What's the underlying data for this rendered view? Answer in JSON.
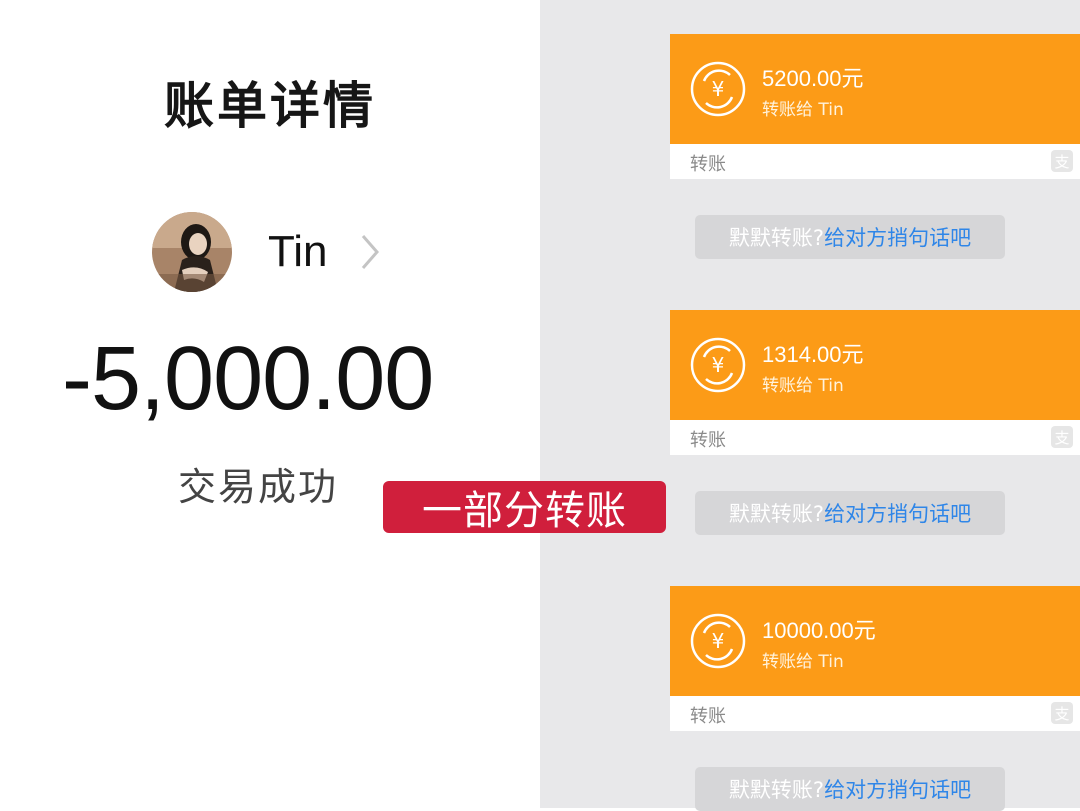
{
  "bill": {
    "title": "账单详情",
    "payee_name": "Tin",
    "amount": "-5,000.00",
    "status": "交易成功"
  },
  "caption": "一部分转账",
  "transfers": [
    {
      "amount": "5200.00元",
      "subtitle": "转账给 Tin",
      "type": "转账"
    },
    {
      "amount": "1314.00元",
      "subtitle": "转账给 Tin",
      "type": "转账"
    },
    {
      "amount": "10000.00元",
      "subtitle": "转账给 Tin",
      "type": "转账"
    }
  ],
  "message_prompt": {
    "prefix": "默默转账?",
    "link": "给对方捎句话吧"
  },
  "colors": {
    "card_orange": "#fc9b17",
    "link_blue": "#2f86e8",
    "caption_red": "#d01f3c",
    "chat_background": "#e8e8ea"
  },
  "icons": {
    "coin": "yuan-coin-transfer-icon",
    "app": "alipay-icon",
    "chevron": "chevron-right-icon"
  }
}
